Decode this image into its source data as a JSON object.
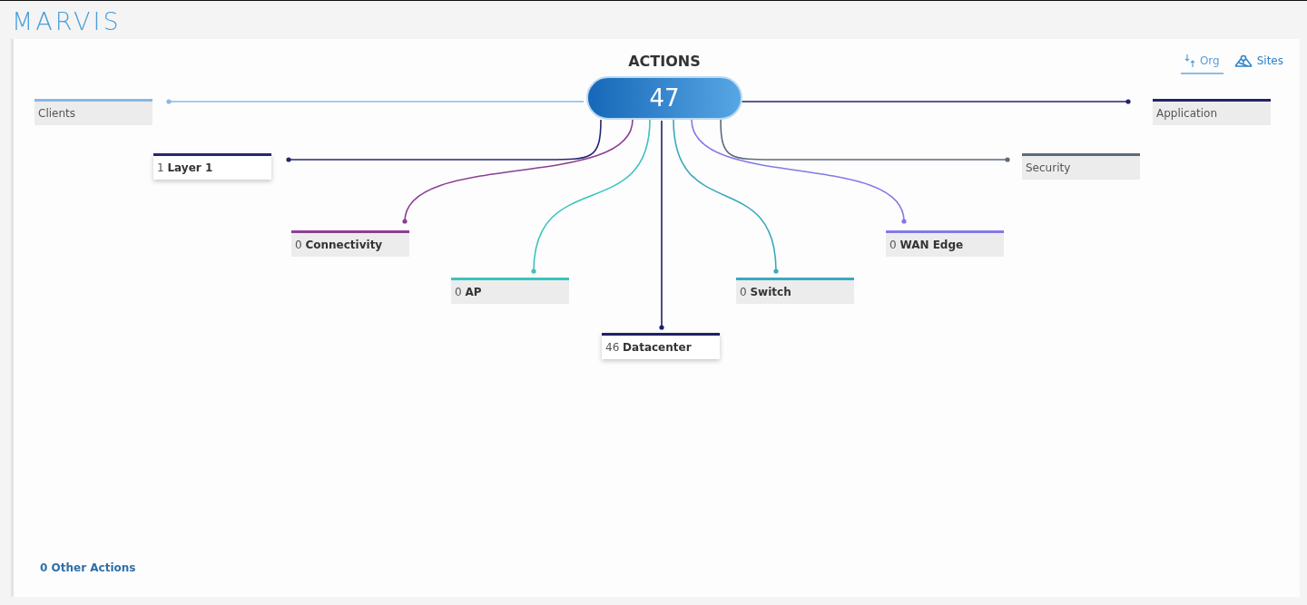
{
  "header": {
    "title": "MARVIS"
  },
  "view_tabs": [
    {
      "label": "Org",
      "selected": true,
      "kind": "org"
    },
    {
      "label": "Sites",
      "selected": false,
      "kind": "sites"
    }
  ],
  "hub": {
    "title": "ACTIONS",
    "count": "47"
  },
  "nodes": [
    {
      "text": "Clients",
      "color": "#8ab8e6",
      "active": false
    },
    {
      "text": "1 **Layer 1**",
      "color": "#26286e",
      "active": true
    },
    {
      "text": "0 **Connectivity**",
      "color": "#8c3f93",
      "active": false
    },
    {
      "text": "0 **AP**",
      "color": "#3cc3be",
      "active": false
    },
    {
      "text": "46 **Datacenter**",
      "color": "#1e2068",
      "active": true
    },
    {
      "text": "0 **Switch**",
      "color": "#3aa9bb",
      "active": false
    },
    {
      "text": "0 **WAN Edge**",
      "color": "#8479e4",
      "active": false
    },
    {
      "text": "Security",
      "color": "#5c6b7a",
      "active": false
    },
    {
      "text": "Application",
      "color": "#24246c",
      "active": false
    }
  ],
  "other_actions": "0 Other Actions"
}
